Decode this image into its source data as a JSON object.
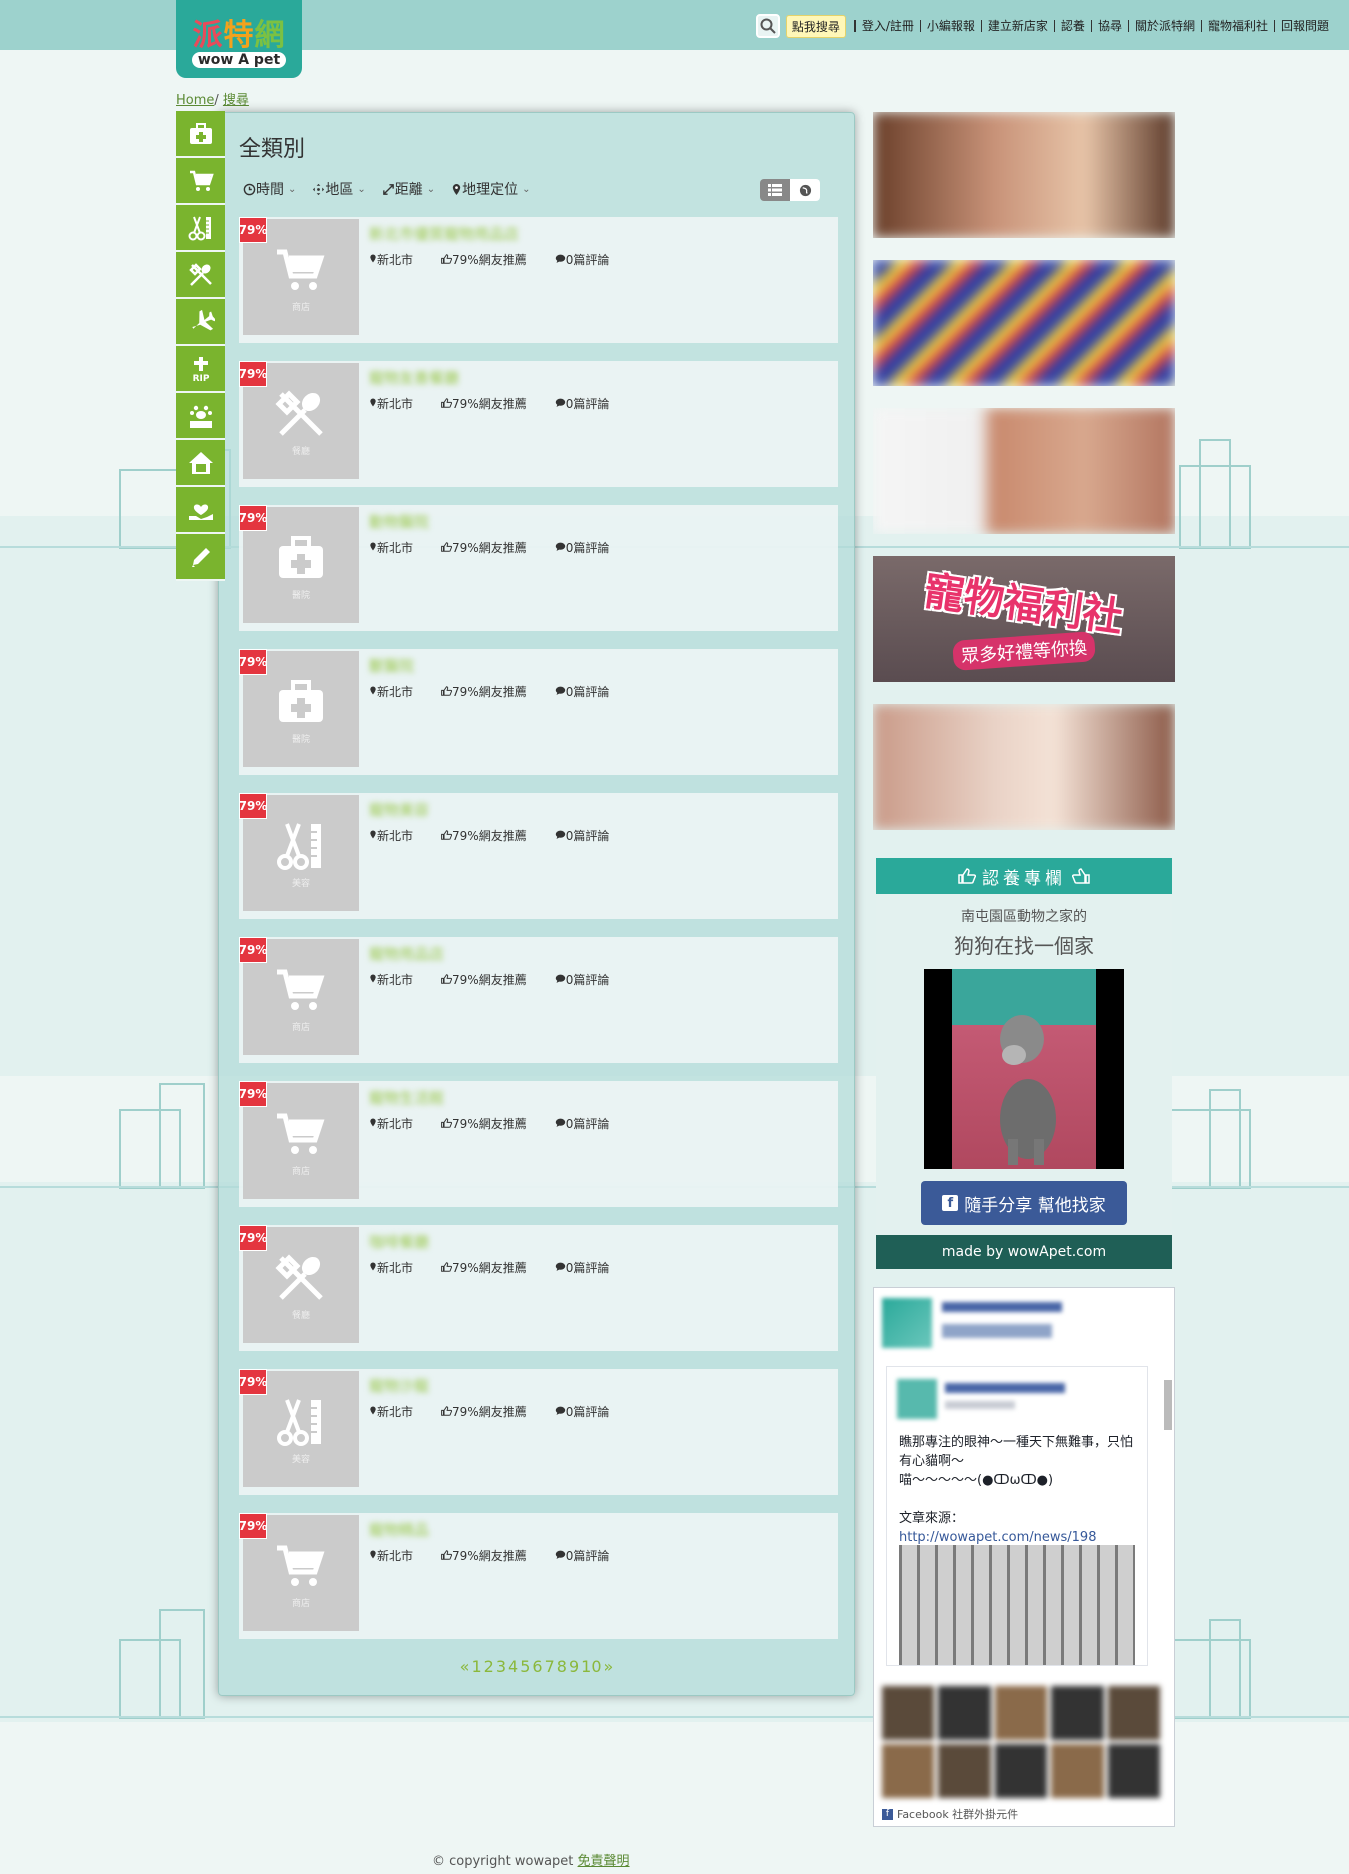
{
  "site": {
    "logo_cn_1": "派",
    "logo_cn_2": "特",
    "logo_cn_3": "網",
    "logo_en": "wow A pet"
  },
  "topnav": {
    "search_hint": "點我搜尋",
    "items": [
      "登入/註冊",
      "小編報報",
      "建立新店家",
      "認養",
      "協尋",
      "關於派特網",
      "寵物福利社",
      "回報問題"
    ]
  },
  "breadcrumb": {
    "home": "Home",
    "sep": "/",
    "current": "搜尋"
  },
  "sidemenu": [
    "medical-icon",
    "shop-icon",
    "grooming-icon",
    "restaurant-icon",
    "travel-icon",
    "memorial-icon",
    "lost-pet-icon",
    "adoption-icon",
    "care-icon",
    "edit-icon"
  ],
  "panel": {
    "title": "全類別",
    "filters": [
      "時間",
      "地區",
      "距離",
      "地理定位"
    ]
  },
  "results": [
    {
      "badge": "79%",
      "category": "商店",
      "icon": "cart-icon",
      "name": "新北市優質寵物用品店",
      "location": "新北市",
      "recommend": "79%網友推薦",
      "reviews": "0篇評論"
    },
    {
      "badge": "79%",
      "category": "餐廳",
      "icon": "fork-spoon-icon",
      "name": "寵物友善餐廳",
      "location": "新北市",
      "recommend": "79%網友推薦",
      "reviews": "0篇評論"
    },
    {
      "badge": "79%",
      "category": "醫院",
      "icon": "medical-icon",
      "name": "動物醫院",
      "location": "新北市",
      "recommend": "79%網友推薦",
      "reviews": "0篇評論"
    },
    {
      "badge": "79%",
      "category": "醫院",
      "icon": "medical-icon",
      "name": "獸醫院",
      "location": "新北市",
      "recommend": "79%網友推薦",
      "reviews": "0篇評論"
    },
    {
      "badge": "79%",
      "category": "美容",
      "icon": "grooming-icon",
      "name": "寵物美容",
      "location": "新北市",
      "recommend": "79%網友推薦",
      "reviews": "0篇評論"
    },
    {
      "badge": "79%",
      "category": "商店",
      "icon": "cart-icon",
      "name": "寵物用品店",
      "location": "新北市",
      "recommend": "79%網友推薦",
      "reviews": "0篇評論"
    },
    {
      "badge": "79%",
      "category": "商店",
      "icon": "cart-icon",
      "name": "寵物生活館",
      "location": "新北市",
      "recommend": "79%網友推薦",
      "reviews": "0篇評論"
    },
    {
      "badge": "79%",
      "category": "餐廳",
      "icon": "fork-spoon-icon",
      "name": "咖啡餐廳",
      "location": "新北市",
      "recommend": "79%網友推薦",
      "reviews": "0篇評論"
    },
    {
      "badge": "79%",
      "category": "美容",
      "icon": "grooming-icon",
      "name": "寵物沙龍",
      "location": "新北市",
      "recommend": "79%網友推薦",
      "reviews": "0篇評論"
    },
    {
      "badge": "79%",
      "category": "商店",
      "icon": "cart-icon",
      "name": "寵物精品",
      "location": "新北市",
      "recommend": "79%網友推薦",
      "reviews": "0篇評論"
    }
  ],
  "pagination": {
    "prev": "«",
    "pages": [
      "1",
      "2",
      "3",
      "4",
      "5",
      "6",
      "7",
      "8",
      "9",
      "10"
    ],
    "next": "»"
  },
  "ads": {
    "welfare_title": "寵物福利社",
    "welfare_sub": "眾多好禮等你換"
  },
  "adopt": {
    "header": "認養專欄",
    "org": "南屯園區動物之家的",
    "tagline": "狗狗在找一個家",
    "share": "隨手分享 幫他找家",
    "footer": "made by wowApet.com"
  },
  "fb": {
    "post_text_1": "瞧那專注的眼神～一種天下無難事，只怕有心貓啊～",
    "post_text_2": "喵～～～～～(●ↀωↀ●)",
    "post_text_3": "文章來源：",
    "post_link": "http://wowapet.com/news/198",
    "footer": "Facebook 社群外掛元件"
  },
  "footer": {
    "copyright": "© copyright wowapet",
    "disclaimer": "免責聲明"
  }
}
